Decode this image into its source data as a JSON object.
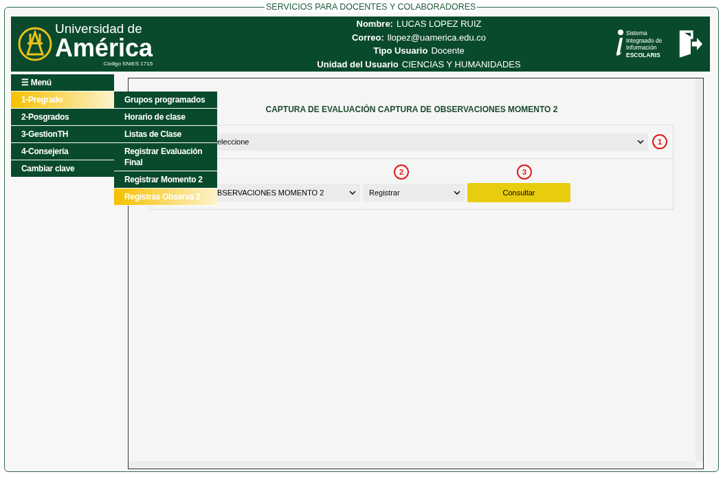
{
  "frame_title": "SERVICIOS PARA DOCENTES Y COLABORADORES",
  "logo": {
    "line1": "Universidad de",
    "line2": "América",
    "code": "Código SNIES 1715"
  },
  "user_info": [
    {
      "label": "Nombre:",
      "value": "LUCAS LOPEZ RUIZ"
    },
    {
      "label": "Correo:",
      "value": "llopez@uamerica.edu.co"
    },
    {
      "label": "Tipo Usuario",
      "value": "Docente"
    },
    {
      "label": "Unidad del Usuario",
      "value": "CIENCIAS Y HUMANIDADES"
    }
  ],
  "system_logo": {
    "lines": [
      "Sistema",
      "Integraado de",
      "Información"
    ],
    "name": "ESCOLARIS"
  },
  "menu": {
    "title": "☰ Menú",
    "items": [
      {
        "label": "1-Pregrado",
        "selected": true
      },
      {
        "label": "2-Posgrados",
        "selected": false
      },
      {
        "label": "3-GestionTH",
        "selected": false
      },
      {
        "label": "4-Consejería",
        "selected": false
      },
      {
        "label": "Cambiar clave",
        "selected": false
      }
    ]
  },
  "submenu": [
    {
      "label": "Grupos programados",
      "selected": false
    },
    {
      "label": "Horario de clase",
      "selected": false
    },
    {
      "label": "Listas de Clase",
      "selected": false
    },
    {
      "label": "Registrar Evaluación Final",
      "selected": false
    },
    {
      "label": "Registrar Momento 2",
      "selected": false
    },
    {
      "label": "Registras Observa 2",
      "selected": true
    }
  ],
  "form": {
    "title": "CAPTURA DE EVALUACIÓN CAPTURA DE OBSERVACIONES MOMENTO 2",
    "select_1": "eleccione",
    "select_2": "BSERVACIONES MOMENTO 2",
    "select_3": "Registrar",
    "button": "Consultar",
    "markers": [
      "1",
      "2",
      "3"
    ]
  }
}
